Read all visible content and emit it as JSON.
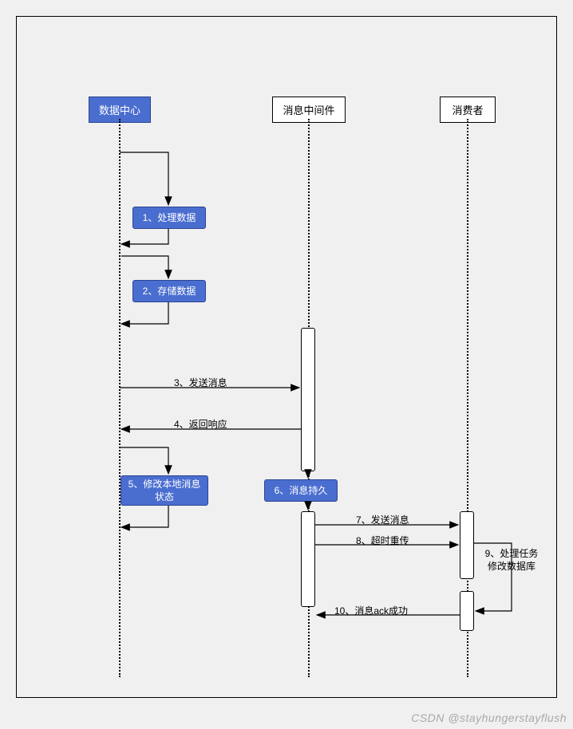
{
  "participants": {
    "p1": "数据中心",
    "p2": "消息中间件",
    "p3": "消费者"
  },
  "steps": {
    "s1": "1、处理数据",
    "s2": "2、存储数据",
    "s3": "3、发送消息",
    "s4": "4、返回响应",
    "s5": "5、修改本地消息状态",
    "s6": "6、消息持久",
    "s7": "7、发送消息",
    "s8": "8、超时重传",
    "s9": "9、处理任务\n修改数据库",
    "s10": "10、消息ack成功"
  },
  "watermark": "CSDN @stayhungerstayflush"
}
